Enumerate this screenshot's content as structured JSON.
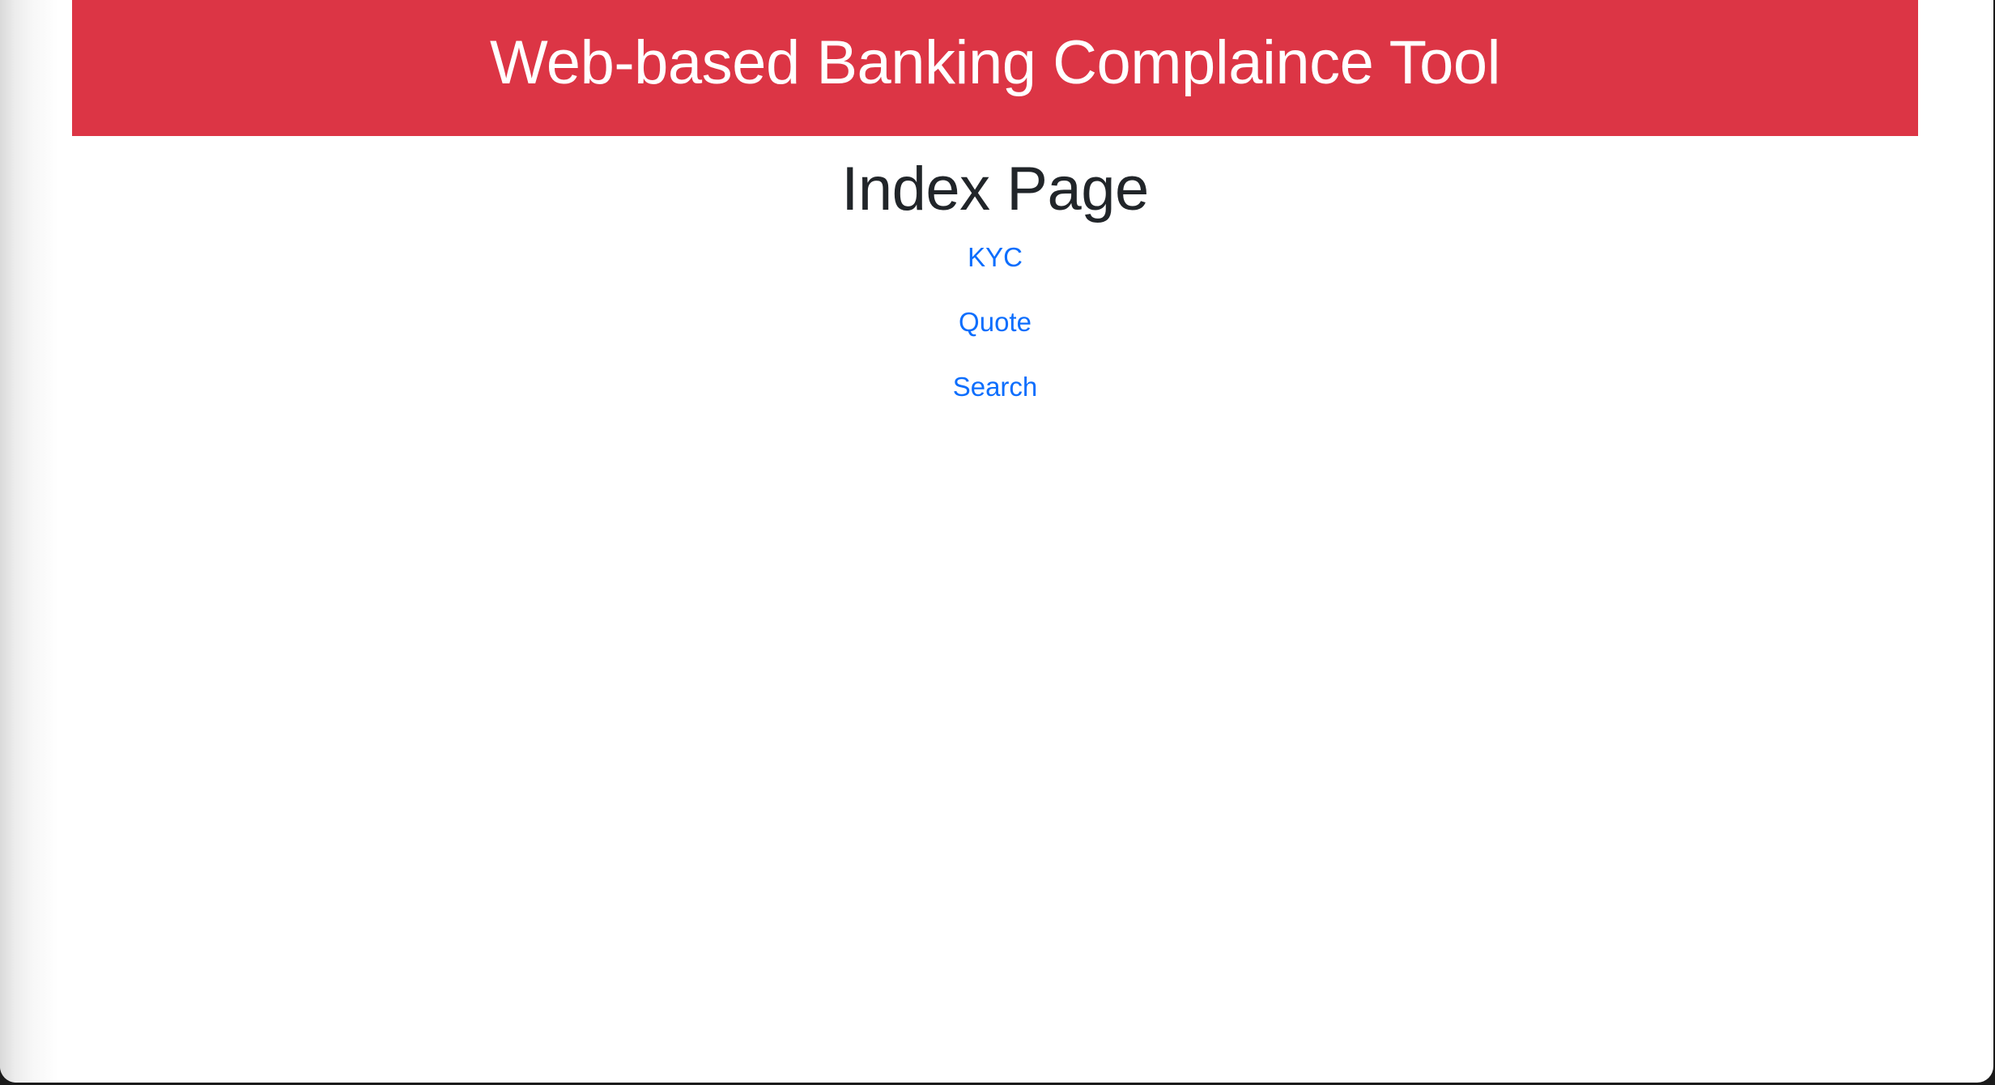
{
  "header": {
    "title": "Web-based Banking Complaince Tool"
  },
  "main": {
    "title": "Index Page",
    "links": [
      {
        "label": "KYC"
      },
      {
        "label": "Quote"
      },
      {
        "label": "Search"
      }
    ]
  },
  "colors": {
    "header_background": "#dc3545",
    "header_text": "#ffffff",
    "title_text": "#212529",
    "link": "#0d6efd"
  }
}
